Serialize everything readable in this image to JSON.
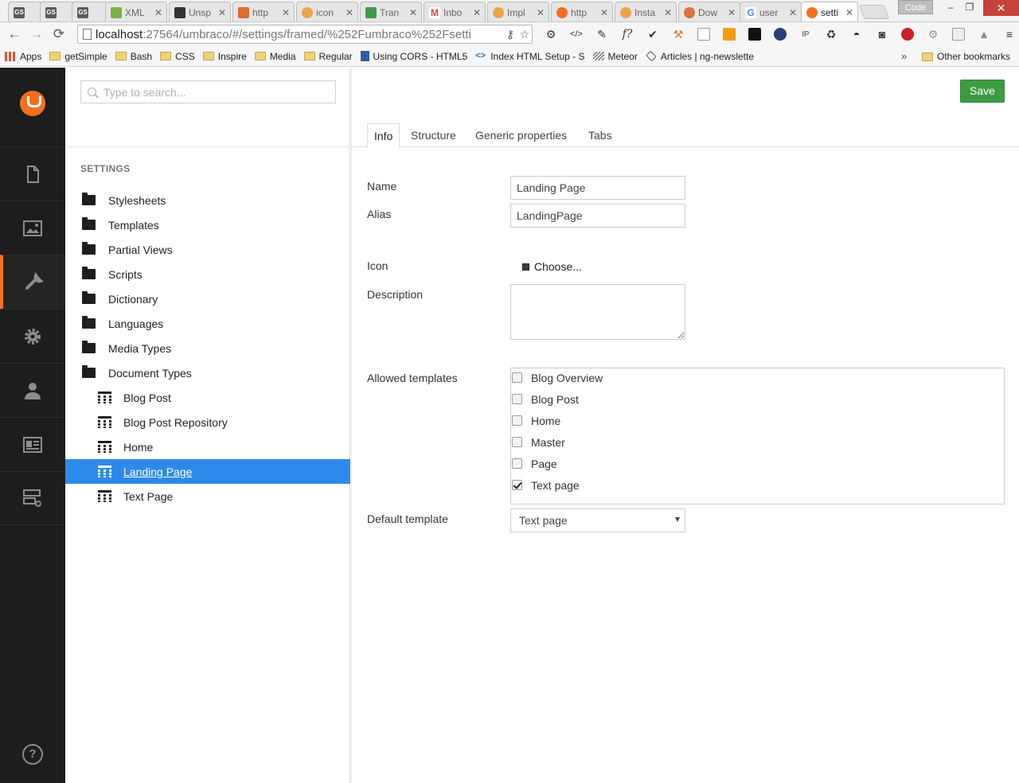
{
  "browser": {
    "tabs": [
      {
        "label": "",
        "icon": "GS",
        "color": "#5a5a5a"
      },
      {
        "label": "",
        "icon": "GS",
        "color": "#5a5a5a"
      },
      {
        "label": "",
        "icon": "GS",
        "color": "#5a5a5a"
      },
      {
        "label": "XML",
        "icon": "",
        "color": "#7cb342"
      },
      {
        "label": "Unsp",
        "icon": "",
        "color": "#333333"
      },
      {
        "label": "http",
        "icon": "",
        "color": "#e06c2f"
      },
      {
        "label": "icon",
        "icon": "",
        "color": "#f0a24b"
      },
      {
        "label": "Tran",
        "icon": "",
        "color": "#3d9a4e"
      },
      {
        "label": "Inbo",
        "icon": "M",
        "color": "#d44638"
      },
      {
        "label": "Impl",
        "icon": "",
        "color": "#f0a24b"
      },
      {
        "label": "http",
        "icon": "",
        "color": "#f36f21"
      },
      {
        "label": "Insta",
        "icon": "",
        "color": "#f0a24b"
      },
      {
        "label": "Dow",
        "icon": "",
        "color": "#d9743a"
      },
      {
        "label": "user",
        "icon": "G",
        "color": "#4285f4"
      },
      {
        "label": "setti",
        "icon": "",
        "color": "#f36f21"
      }
    ],
    "window_user": "Code",
    "url_host": "localhost",
    "url_path": ":27564/umbraco/#/settings/framed/%252Fumbraco%252Fsetti",
    "bookmarks": [
      {
        "label": "Apps",
        "type": "apps"
      },
      {
        "label": "getSimple",
        "type": "folder"
      },
      {
        "label": "Bash",
        "type": "folder"
      },
      {
        "label": "CSS",
        "type": "folder"
      },
      {
        "label": "Inspire",
        "type": "folder"
      },
      {
        "label": "Media",
        "type": "folder"
      },
      {
        "label": "Regular",
        "type": "folder"
      },
      {
        "label": "Using CORS - HTML5",
        "type": "html5"
      },
      {
        "label": "Index HTML Setup - S",
        "type": "code"
      },
      {
        "label": "Meteor",
        "type": "meteor"
      },
      {
        "label": "Articles | ng-newslette",
        "type": "ng"
      }
    ],
    "bookmarks_more": "»",
    "other_bookmarks": "Other bookmarks"
  },
  "umbraco": {
    "accent": "#f36f21",
    "search_placeholder": "Type to search...",
    "tree_header": "SETTINGS",
    "tree_nodes": [
      {
        "label": "Stylesheets"
      },
      {
        "label": "Templates"
      },
      {
        "label": "Partial Views"
      },
      {
        "label": "Scripts"
      },
      {
        "label": "Dictionary"
      },
      {
        "label": "Languages"
      },
      {
        "label": "Media Types"
      },
      {
        "label": "Document Types"
      },
      {
        "label": "Blog Post"
      },
      {
        "label": "Blog Post Repository"
      },
      {
        "label": "Home"
      },
      {
        "label": "Landing Page"
      },
      {
        "label": "Text Page"
      }
    ],
    "save_label": "Save",
    "tabs": [
      "Info",
      "Structure",
      "Generic properties",
      "Tabs"
    ],
    "form": {
      "name_label": "Name",
      "name_value": "Landing Page",
      "alias_label": "Alias",
      "alias_value": "LandingPage",
      "icon_label": "Icon",
      "icon_choose": "Choose...",
      "description_label": "Description",
      "description_value": "",
      "allowed_templates_label": "Allowed templates",
      "templates": [
        {
          "label": "Blog Overview",
          "checked": false
        },
        {
          "label": "Blog Post",
          "checked": false
        },
        {
          "label": "Home",
          "checked": false
        },
        {
          "label": "Master",
          "checked": false
        },
        {
          "label": "Page",
          "checked": false
        },
        {
          "label": "Text page",
          "checked": true
        }
      ],
      "default_template_label": "Default template",
      "default_template_value": "Text page"
    }
  }
}
